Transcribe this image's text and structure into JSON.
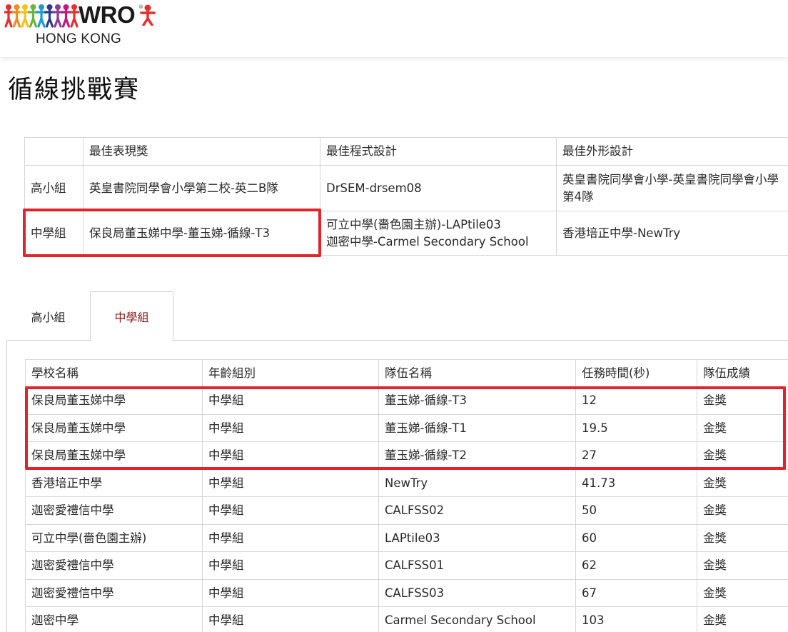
{
  "brand": {
    "logo_word": "WRO",
    "logo_sub": "HONG KONG",
    "figure_colors": [
      "#e62e2d",
      "#f28b1c",
      "#f5c21b",
      "#6cb33f",
      "#1b9ad6",
      "#2d3a8c",
      "#8e3c97",
      "#c2187b",
      "#e62e2d"
    ]
  },
  "page": {
    "title": "循線挑戰賽"
  },
  "awards": {
    "headers": [
      "",
      "最佳表現獎",
      "最佳程式設計",
      "最佳外形設計"
    ],
    "rows": [
      {
        "group": "高小組",
        "performance": "英皇書院同學會小學第二校-英二B隊",
        "programming": [
          "DrSEM-drsem08"
        ],
        "design": "英皇書院同學會小學-英皇書院同學會小學第4隊"
      },
      {
        "group": "中學組",
        "performance": "保良局董玉娣中學-董玉娣-循線-T3",
        "programming": [
          "可立中學(嗇色園主辦)-LAPtile03",
          "迦密中學-Carmel Secondary School"
        ],
        "design": "香港培正中學-NewTry"
      }
    ]
  },
  "tabs": {
    "primary": "高小組",
    "secondary": "中學組",
    "active": "中學組"
  },
  "results": {
    "headers": [
      "學校名稱",
      "年齡組別",
      "隊伍名稱",
      "任務時間(秒)",
      "隊伍成績"
    ],
    "rows": [
      [
        "保良局董玉娣中學",
        "中學組",
        "董玉娣-循線-T3",
        "12",
        "金獎"
      ],
      [
        "保良局董玉娣中學",
        "中學組",
        "董玉娣-循線-T1",
        "19.5",
        "金獎"
      ],
      [
        "保良局董玉娣中學",
        "中學組",
        "董玉娣-循線-T2",
        "27",
        "金獎"
      ],
      [
        "香港培正中學",
        "中學組",
        "NewTry",
        "41.73",
        "金獎"
      ],
      [
        "迦密愛禮信中學",
        "中學組",
        "CALFSS02",
        "50",
        "金獎"
      ],
      [
        "可立中學(嗇色園主辦)",
        "中學組",
        "LAPtile03",
        "60",
        "金獎"
      ],
      [
        "迦密愛禮信中學",
        "中學組",
        "CALFSS01",
        "62",
        "金獎"
      ],
      [
        "迦密愛禮信中學",
        "中學組",
        "CALFSS03",
        "67",
        "金獎"
      ],
      [
        "迦密中學",
        "中學組",
        "Carmel Secondary School",
        "103",
        "金獎"
      ]
    ]
  },
  "highlight_color": "#e0242b"
}
